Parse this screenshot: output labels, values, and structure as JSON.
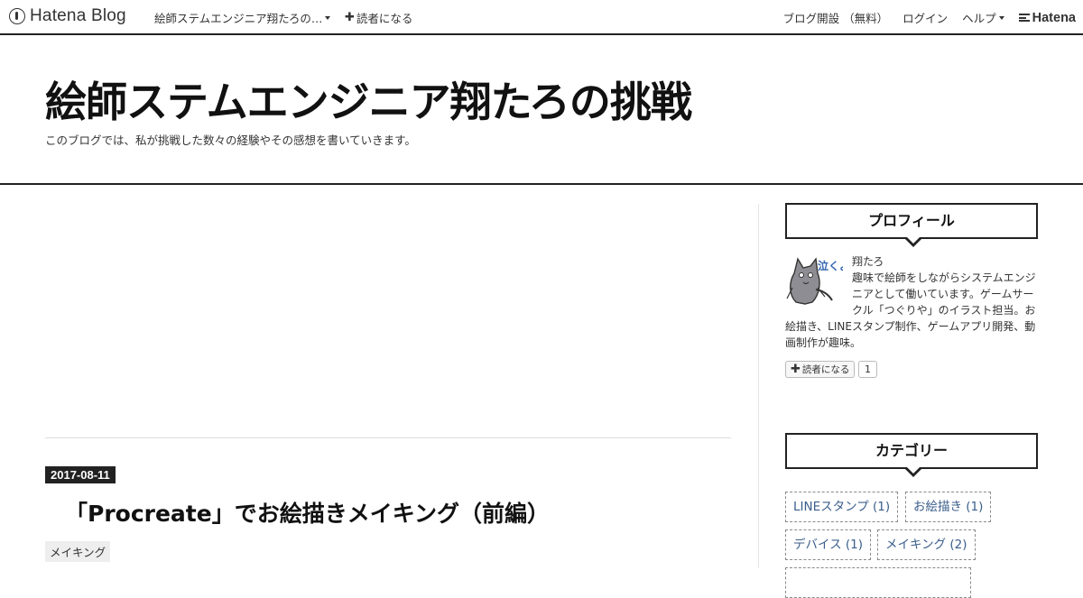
{
  "globalbar": {
    "logo_text": "Hatena Blog",
    "blog_name": "絵師ステムエンジニア翔たろの…",
    "subscribe_label": "読者になる",
    "subscribe_plus": "✚",
    "right": {
      "open_blog": "ブログ開設 （無料）",
      "login": "ログイン",
      "help": "ヘルプ",
      "hatena": "Hatena"
    }
  },
  "header": {
    "title": "絵師ステムエンジニア翔たろの挑戦",
    "description": "このブログでは、私が挑戦した数々の経験やその感想を書いていきます。"
  },
  "entry": {
    "date": "2017-08-11",
    "title": "「Procreate」でお絵描きメイキング（前編）",
    "category": "メイキング"
  },
  "sidebar": {
    "profile": {
      "title": "プロフィール",
      "name": "翔たろ",
      "bio": "趣味で絵師をしながらシステムエンジニアとして働いています。ゲームサークル「つぐりや」のイラスト担当。お絵描き、LINEスタンプ制作、ゲームアプリ開発、動画制作が趣味。",
      "subscribe_label": "読者になる",
      "subscribe_plus": "✚",
      "subscriber_count": "1",
      "avatar_text": "泣くよ?"
    },
    "categories": {
      "title": "カテゴリー",
      "items": [
        {
          "label": "LINEスタンプ (1)"
        },
        {
          "label": "お絵描き (1)"
        },
        {
          "label": "デバイス (1)"
        },
        {
          "label": "メイキング (2)"
        }
      ]
    }
  },
  "colors": {
    "dark": "#222222",
    "link": "#3b5e8c",
    "tag_bg": "#eeeeee"
  }
}
